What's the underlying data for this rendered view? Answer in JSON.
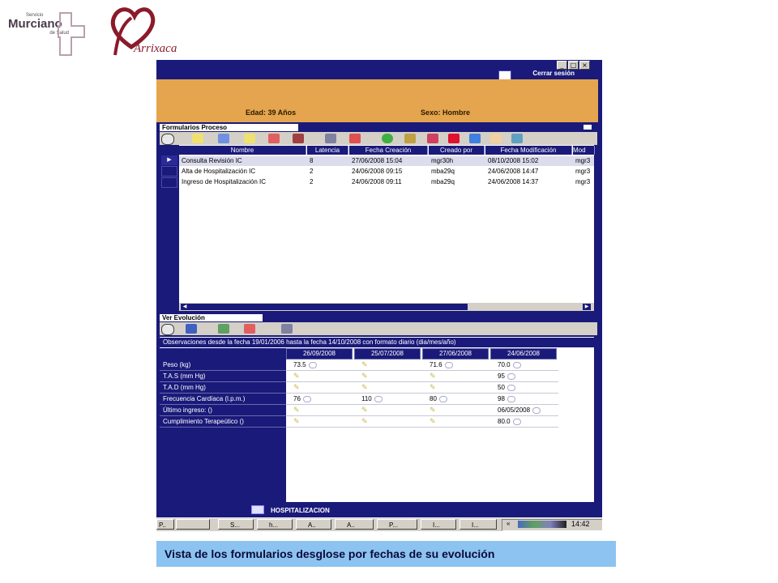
{
  "logos": {
    "sms_line1": "Servicio",
    "sms_line2": "Murciano",
    "sms_line3": "de Salud",
    "arrixaca": "Arrixaca"
  },
  "window": {
    "logout_label": "Cerrar sesión",
    "patient": {
      "age": "Edad: 39 Años",
      "sex": "Sexo: Hombre"
    }
  },
  "forms": {
    "section_label": "Formularios Proceso",
    "columns": [
      "Nombre",
      "Latencia",
      "Fecha Creación",
      "Creado por",
      "Fecha Modificación",
      "Mod"
    ],
    "rows": [
      [
        "Consulta Revisión IC",
        "8",
        "27/06/2008 15:04",
        "mgr30h",
        "08/10/2008 15:02",
        "mgr3"
      ],
      [
        "Alta de Hospitalización IC",
        "2",
        "24/06/2008 09:15",
        "mba29q",
        "24/06/2008 14:47",
        "mgr3"
      ],
      [
        "Ingreso de Hospitalización IC",
        "2",
        "24/06/2008 09:11",
        "mba29q",
        "24/06/2008 14:37",
        "mgr3"
      ]
    ]
  },
  "evolution": {
    "section_label": "Ver Evolución",
    "observation": "Observaciones desde la fecha 19/01/2006 hasta la fecha 14/10/2008 con formato diario (dia/mes/año)",
    "dates": [
      "26/09/2008",
      "25/07/2008",
      "27/06/2008",
      "24/06/2008"
    ],
    "rows": [
      {
        "label": "Peso (kg)",
        "values": [
          "73.5",
          "",
          "71.6",
          "70.0"
        ]
      },
      {
        "label": "T.A.S (mm Hg)",
        "values": [
          "",
          "",
          "",
          "95"
        ]
      },
      {
        "label": "T.A.D (mm Hg)",
        "values": [
          "",
          "",
          "",
          "50"
        ]
      },
      {
        "label": "Frecuencia Cardíaca (l.p.m.)",
        "values": [
          "76",
          "110",
          "80",
          "98"
        ]
      },
      {
        "label": "Último ingreso: ()",
        "values": [
          "",
          "",
          "",
          "06/05/2008"
        ]
      },
      {
        "label": "Cumplimiento Terapeútico ()",
        "values": [
          "",
          "",
          "",
          "80.0"
        ]
      }
    ]
  },
  "status": {
    "label": "HOSPITALIZACION"
  },
  "taskbar": {
    "buttons": [
      "P..",
      "",
      "S...",
      "h...",
      "A..",
      "A..",
      "P...",
      "I...",
      "I..."
    ],
    "time": "14:42"
  },
  "caption": "Vista de los formularios desglose por fechas de su evolución"
}
